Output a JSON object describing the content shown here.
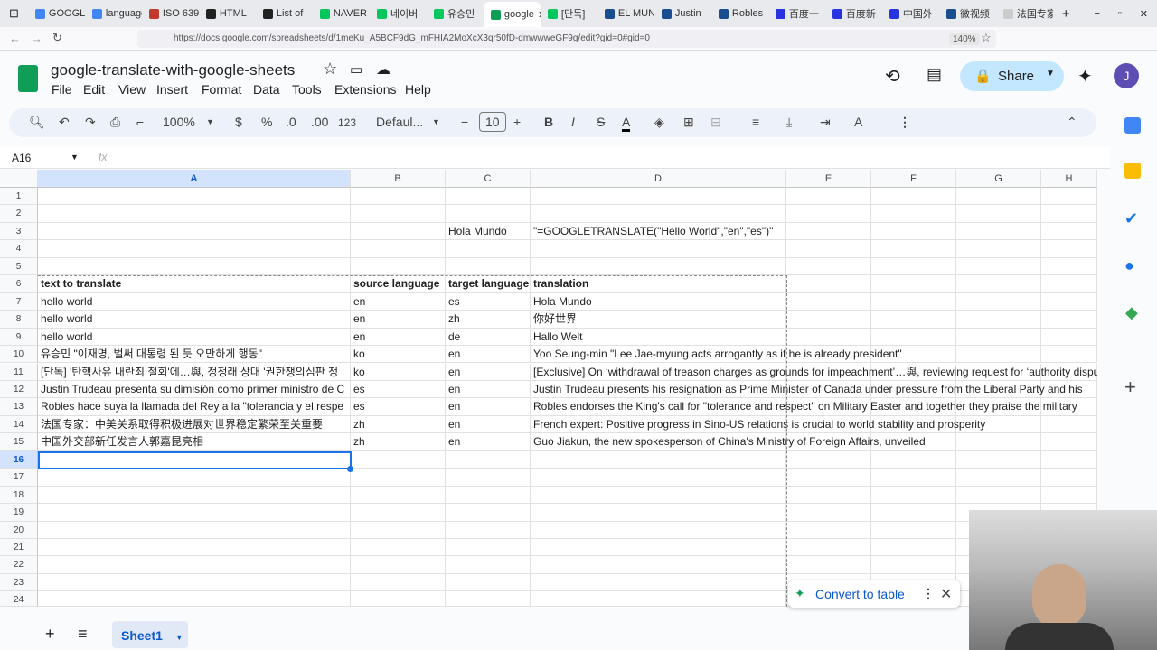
{
  "browser": {
    "tabs": [
      {
        "label": "GOOGLE",
        "color": "#4285f4"
      },
      {
        "label": "language",
        "color": "#4285f4"
      },
      {
        "label": "ISO 639",
        "color": "#c0392b"
      },
      {
        "label": "HTML",
        "color": "#222"
      },
      {
        "label": "List of",
        "color": "#222"
      },
      {
        "label": "NAVER",
        "color": "#03c75a"
      },
      {
        "label": "네이버",
        "color": "#03c75a"
      },
      {
        "label": "유승민",
        "color": "#03c75a"
      },
      {
        "label": "google",
        "color": "#0f9d58",
        "active": true
      },
      {
        "label": "[단독]",
        "color": "#03c75a"
      },
      {
        "label": "EL MUNDO",
        "color": "#1a4d8f"
      },
      {
        "label": "Justin",
        "color": "#1a4d8f"
      },
      {
        "label": "Robles",
        "color": "#1a4d8f"
      },
      {
        "label": "百度一",
        "color": "#2932e1"
      },
      {
        "label": "百度新",
        "color": "#2932e1"
      },
      {
        "label": "中国外",
        "color": "#2932e1"
      },
      {
        "label": "微视频",
        "color": "#1a4d8f"
      },
      {
        "label": "法国专家:",
        "color": "#ccc"
      }
    ],
    "url": "https://docs.google.com/spreadsheets/d/1meKu_A5BCF9dG_mFHIA2MoXcX3qr50fD-dmwwweGF9g/edit?gid=0#gid=0",
    "zoom": "140%"
  },
  "doc": {
    "title": "google-translate-with-google-sheets",
    "menus": [
      "File",
      "Edit",
      "View",
      "Insert",
      "Format",
      "Data",
      "Tools",
      "Extensions",
      "Help"
    ],
    "share": "Share",
    "avatar": "J"
  },
  "toolbar": {
    "zoom": "100%",
    "currency": "$",
    "percent": "%",
    "dec_minus": ".0",
    "dec_plus": ".00",
    "format123": "123",
    "font": "Defaul...",
    "font_size": "10",
    "bold": "B",
    "italic": "I",
    "strike": "S",
    "text_color": "A"
  },
  "formula_bar": {
    "cell_ref": "A16",
    "fx": "fx",
    "value": ""
  },
  "columns": [
    "A",
    "B",
    "C",
    "D",
    "E",
    "F",
    "G",
    "H"
  ],
  "selected": {
    "row": 16,
    "col": "A"
  },
  "rows": [
    [],
    [],
    [
      "",
      "",
      "Hola Mundo",
      "\"=GOOGLETRANSLATE(\"Hello World\",\"en\",\"es\")\""
    ],
    [],
    [],
    [
      "text to translate",
      "source language",
      "target language",
      "translation"
    ],
    [
      "hello world",
      "en",
      "es",
      "Hola Mundo"
    ],
    [
      "hello world",
      "en",
      "zh",
      "你好世界"
    ],
    [
      "hello world",
      "en",
      "de",
      "Hallo Welt"
    ],
    [
      " 유승민 \"이재명, 벌써 대통령 된 듯 오만하게 행동\"",
      "ko",
      "en",
      " Yoo Seung-min \"Lee Jae-myung acts arrogantly as if he is already president\""
    ],
    [
      " [단독] '탄핵사유 내란죄 철회'에…與, 정청래 상대 '권한쟁의심판 청",
      "ko",
      "en",
      " [Exclusive] On ‘withdrawal of treason charges as grounds for impeachment’…與, reviewing request for ‘authority dispute’"
    ],
    [
      "Justin Trudeau presenta su dimisión como primer ministro de C",
      "es",
      "en",
      "Justin Trudeau presents his resignation as Prime Minister of Canada under pressure from the Liberal Party and his"
    ],
    [
      "Robles hace suya la llamada del Rey a la \"tolerancia y el respe",
      "es",
      "en",
      "Robles endorses the King's call for \"tolerance and respect\" on Military Easter and together they praise the military"
    ],
    [
      "法国专家：中美关系取得积极进展对世界稳定繁荣至关重要",
      "zh",
      "en",
      "French expert: Positive progress in Sino-US relations is crucial to world stability and prosperity"
    ],
    [
      "中国外交部新任发言人郭嘉昆亮相",
      "zh",
      "en",
      "Guo Jiakun, the new spokesperson of China's Ministry of Foreign Affairs, unveiled"
    ],
    [],
    [],
    [],
    [],
    [],
    [],
    [],
    [],
    []
  ],
  "header_row": 6,
  "sheets": [
    {
      "label": "Sheet1"
    }
  ],
  "convert": {
    "label": "Convert to table",
    "icon": "sparkle-icon"
  }
}
